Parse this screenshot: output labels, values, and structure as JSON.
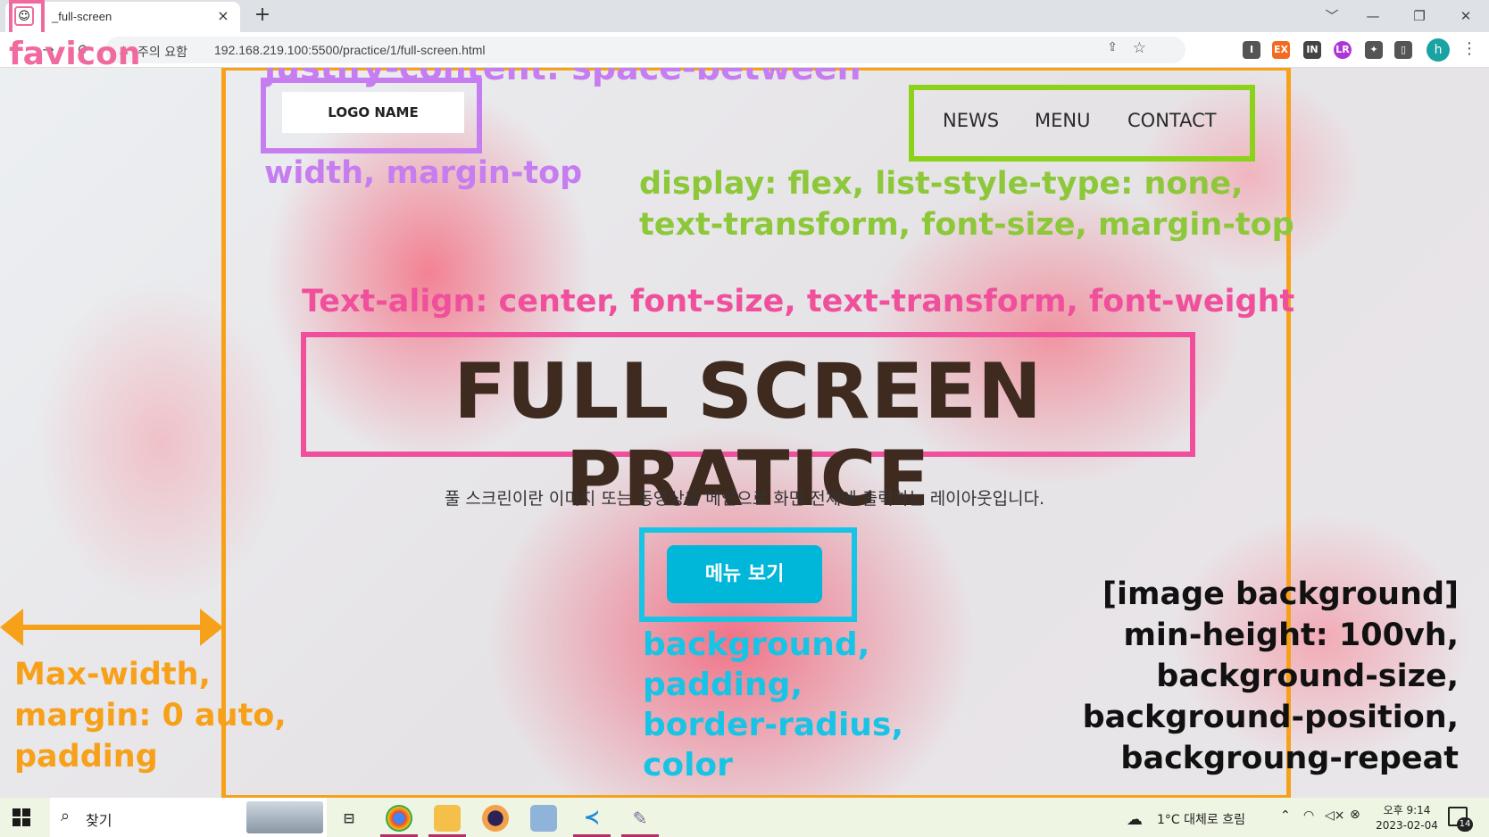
{
  "browser": {
    "tab_title": "_full-screen",
    "tab_favicon_icon": "smiley-favicon-icon",
    "tab_close": "×",
    "new_tab": "+",
    "security_warning": "주의 요함",
    "url": "192.168.219.100:5500/practice/1/full-screen.html",
    "window_controls": [
      "﹀",
      "—",
      "❐",
      "✕"
    ]
  },
  "extensions": [
    {
      "label": "I",
      "color": "#555555"
    },
    {
      "label": "EX",
      "color": "#f36b21"
    },
    {
      "label": "IN",
      "color": "#444444"
    },
    {
      "label": "LR",
      "color": "#b035d6"
    },
    {
      "label": "✦",
      "color": "#555555"
    },
    {
      "label": "▯",
      "color": "#555555"
    }
  ],
  "profile_initial": "h",
  "page": {
    "logo": "LOGO NAME",
    "nav": [
      "NEWS",
      "MENU",
      "CONTACT"
    ],
    "title": "FULL SCREEN PRATICE",
    "description": "풀 스크린이란 이미지 또는 동영상을 메인으로 화면 전체에 출력하는 레이아웃입니다.",
    "button": "메뉴 보기"
  },
  "annotations": {
    "favicon": "favicon",
    "justify": "justify-content: space-between",
    "logo": "width, margin-top",
    "nav_line1": "display: flex, list-style-type: none,",
    "nav_line2": "text-transform, font-size, margin-top",
    "title": "Text-align: center, font-size, text-transform, font-weight",
    "button_lines": [
      "background,",
      "padding,",
      "border-radius,",
      "color"
    ],
    "container_lines": [
      "Max-width,",
      "margin: 0 auto,",
      "padding"
    ],
    "background_lines": [
      "[image background]",
      "min-height: 100vh,",
      "background-size,",
      "background-position,",
      "backgroung-repeat"
    ]
  },
  "colors": {
    "container_border": "#f7a11a",
    "logo_border": "#c67df0",
    "nav_border": "#8cd11a",
    "title_border": "#f0509b",
    "button_border": "#17c4e6",
    "button_bg": "#00b7d9",
    "title_text": "#3e2a1f"
  },
  "taskbar": {
    "search_placeholder": "찾기",
    "weather": "1°C  대체로 흐림",
    "time": "오후 9:14",
    "date": "2023-02-04",
    "notification_count": "14"
  }
}
